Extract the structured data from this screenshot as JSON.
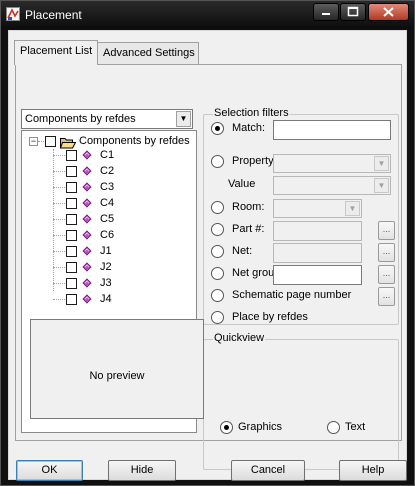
{
  "window": {
    "title": "Placement",
    "icon": "placement-app-icon",
    "controls": [
      "minimize-icon",
      "maximize-icon",
      "close-icon"
    ]
  },
  "tabs": [
    {
      "label": "Placement List",
      "active": true
    },
    {
      "label": "Advanced Settings",
      "active": false
    }
  ],
  "list_filter": {
    "selected": "Components by refdes"
  },
  "tree": {
    "root": {
      "label": "Components by refdes",
      "expanded": true,
      "checked": false
    },
    "items": [
      "C1",
      "C2",
      "C3",
      "C4",
      "C5",
      "C6",
      "J1",
      "J2",
      "J3",
      "J4"
    ]
  },
  "selection_filters": {
    "title": "Selection filters",
    "selected": "Match",
    "options": {
      "match": {
        "label": "Match:",
        "value": ""
      },
      "property": {
        "label": "Property:",
        "value": ""
      },
      "value": {
        "label": "Value",
        "value": ""
      },
      "room": {
        "label": "Room:",
        "value": ""
      },
      "part": {
        "label": "Part #:",
        "value": ""
      },
      "net": {
        "label": "Net:",
        "value": ""
      },
      "net_group": {
        "label": "Net group",
        "value": ""
      },
      "schematic_page": {
        "label": "Schematic page number"
      },
      "place_by_refdes": {
        "label": "Place by refdes"
      }
    },
    "ellipsis": "..."
  },
  "quickview": {
    "title": "Quickview",
    "preview_text": "No preview",
    "mode": "Graphics",
    "modes": [
      "Graphics",
      "Text"
    ]
  },
  "buttons": {
    "ok": "OK",
    "hide": "Hide",
    "cancel": "Cancel",
    "help": "Help"
  },
  "colors": {
    "titlebar": "#1a1a1a",
    "face": "#f0f0f0",
    "component_icon": "#c050c8",
    "folder_icon": "#f2d27a",
    "close_button": "#c7432b"
  }
}
